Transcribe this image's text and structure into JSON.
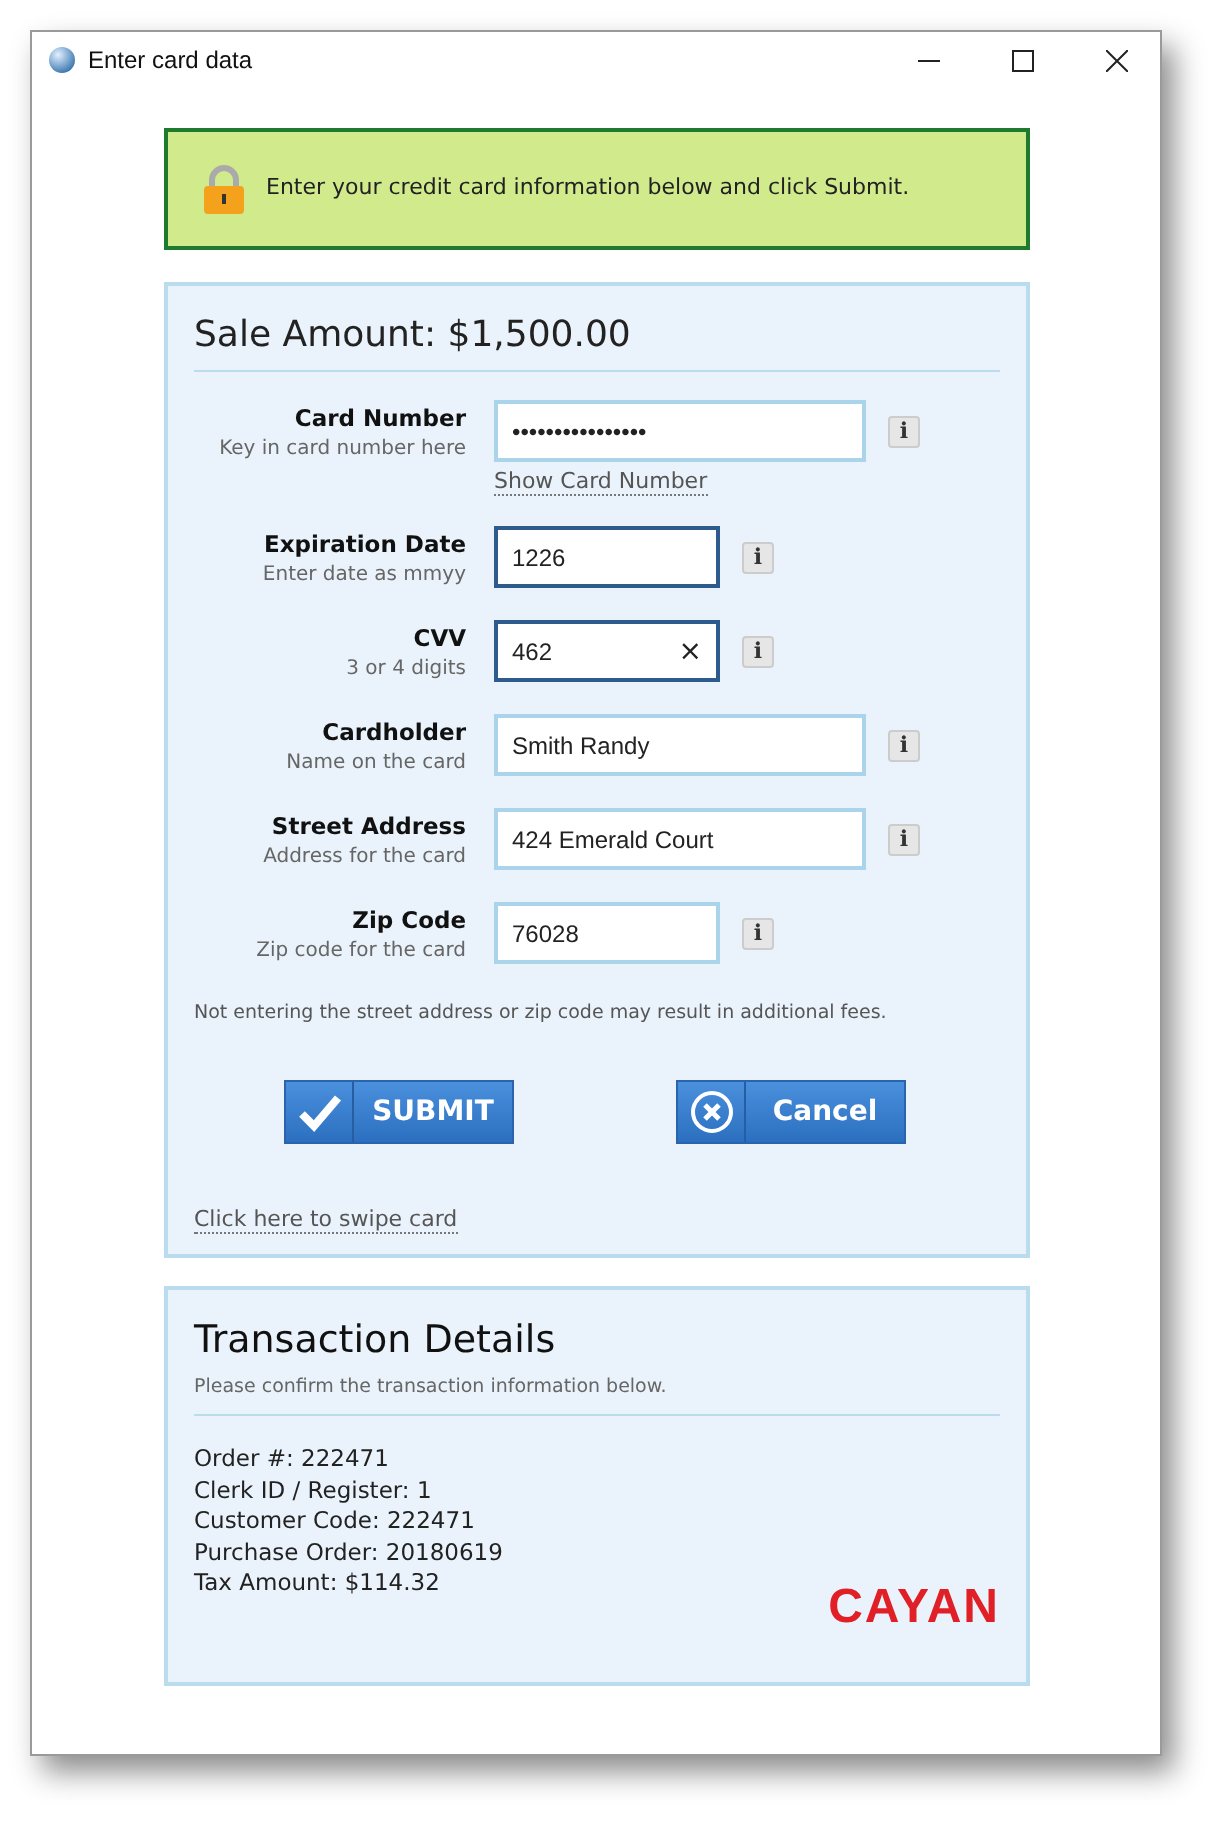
{
  "window": {
    "title": "Enter card data"
  },
  "banner": {
    "text": "Enter your credit card information below and click Submit."
  },
  "sale": {
    "title": "Sale Amount: $1,500.00",
    "fields": [
      {
        "label": "Card Number",
        "hint": "Key in card number here",
        "value": "••••••••••••••••",
        "kind": "wide",
        "focused": false,
        "info": "i",
        "link": "Show Card Number"
      },
      {
        "label": "Expiration Date",
        "hint": "Enter date as mmyy",
        "value": "1226",
        "kind": "narrow",
        "focused": true,
        "info": "i"
      },
      {
        "label": "CVV",
        "hint": "3 or 4 digits",
        "value": "462",
        "kind": "narrow",
        "focused": true,
        "clear_glyph": "×",
        "info": "i"
      },
      {
        "label": "Cardholder",
        "hint": "Name on the card",
        "value": "Smith Randy",
        "kind": "wide",
        "focused": false,
        "info": "i"
      },
      {
        "label": "Street Address",
        "hint": "Address for the card",
        "value": "424 Emerald Court",
        "kind": "wide",
        "focused": false,
        "info": "i"
      },
      {
        "label": "Zip Code",
        "hint": "Zip code for the card",
        "value": "76028",
        "kind": "narrow",
        "focused": false,
        "info": "i"
      }
    ],
    "note": "Not entering the street address or zip code may result in additional fees.",
    "buttons": [
      {
        "label": "SUBMIT",
        "kind": "submit"
      },
      {
        "label": "Cancel",
        "kind": "cancel"
      }
    ],
    "swipe_link": "Click here to swipe card"
  },
  "transaction": {
    "title": "Transaction Details",
    "subtitle": "Please confirm the transaction information below.",
    "lines": [
      "Order #: 222471",
      "Clerk ID / Register: 1",
      "Customer Code: 222471",
      "Purchase Order: 20180619",
      "Tax Amount: $114.32"
    ],
    "logo": "CAYAN"
  }
}
